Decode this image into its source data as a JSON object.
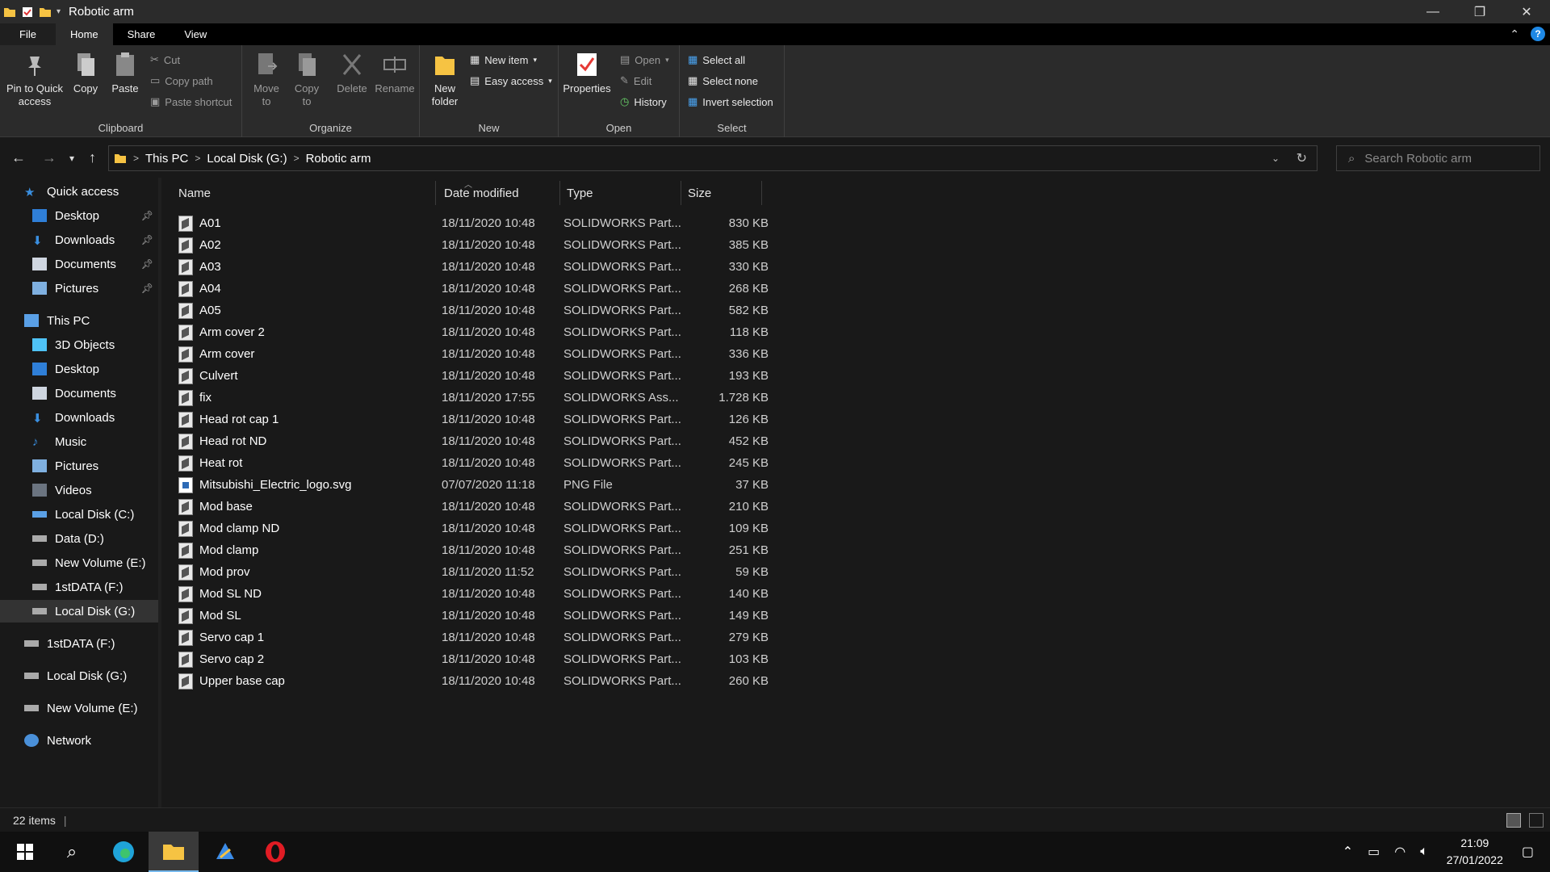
{
  "window": {
    "title": "Robotic arm"
  },
  "ribbon_tabs": [
    "File",
    "Home",
    "Share",
    "View"
  ],
  "ribbon": {
    "clipboard": {
      "label": "Clipboard",
      "pin": "Pin to Quick access",
      "copy": "Copy",
      "paste": "Paste",
      "cut": "Cut",
      "copy_path": "Copy path",
      "paste_shortcut": "Paste shortcut"
    },
    "organize": {
      "label": "Organize",
      "move_to": "Move to",
      "copy_to": "Copy to",
      "delete": "Delete",
      "rename": "Rename"
    },
    "new": {
      "label": "New",
      "new_folder": "New folder",
      "new_item": "New item",
      "easy_access": "Easy access"
    },
    "open": {
      "label": "Open",
      "properties": "Properties",
      "open": "Open",
      "edit": "Edit",
      "history": "History"
    },
    "select": {
      "label": "Select",
      "select_all": "Select all",
      "select_none": "Select none",
      "invert": "Invert selection"
    }
  },
  "address": {
    "crumbs": [
      "This PC",
      "Local Disk (G:)",
      "Robotic arm"
    ],
    "search_placeholder": "Search Robotic arm"
  },
  "sidebar": {
    "quick_access": "Quick access",
    "quick_items": [
      "Desktop",
      "Downloads",
      "Documents",
      "Pictures"
    ],
    "this_pc": "This PC",
    "pc_items": [
      "3D Objects",
      "Desktop",
      "Documents",
      "Downloads",
      "Music",
      "Pictures",
      "Videos",
      "Local Disk (C:)",
      "Data (D:)",
      "New Volume (E:)",
      "1stDATA (F:)",
      "Local Disk (G:)"
    ],
    "drives": [
      "1stDATA (F:)",
      "Local Disk (G:)",
      "New Volume (E:)"
    ],
    "network": "Network"
  },
  "columns": {
    "name": "Name",
    "date": "Date modified",
    "type": "Type",
    "size": "Size"
  },
  "files": [
    {
      "name": "A01",
      "date": "18/11/2020 10:48",
      "type": "SOLIDWORKS Part...",
      "size": "830 KB"
    },
    {
      "name": "A02",
      "date": "18/11/2020 10:48",
      "type": "SOLIDWORKS Part...",
      "size": "385 KB"
    },
    {
      "name": "A03",
      "date": "18/11/2020 10:48",
      "type": "SOLIDWORKS Part...",
      "size": "330 KB"
    },
    {
      "name": "A04",
      "date": "18/11/2020 10:48",
      "type": "SOLIDWORKS Part...",
      "size": "268 KB"
    },
    {
      "name": "A05",
      "date": "18/11/2020 10:48",
      "type": "SOLIDWORKS Part...",
      "size": "582 KB"
    },
    {
      "name": "Arm cover 2",
      "date": "18/11/2020 10:48",
      "type": "SOLIDWORKS Part...",
      "size": "118 KB"
    },
    {
      "name": "Arm cover",
      "date": "18/11/2020 10:48",
      "type": "SOLIDWORKS Part...",
      "size": "336 KB"
    },
    {
      "name": "Culvert",
      "date": "18/11/2020 10:48",
      "type": "SOLIDWORKS Part...",
      "size": "193 KB"
    },
    {
      "name": "fix",
      "date": "18/11/2020 17:55",
      "type": "SOLIDWORKS Ass...",
      "size": "1.728 KB"
    },
    {
      "name": "Head rot cap 1",
      "date": "18/11/2020 10:48",
      "type": "SOLIDWORKS Part...",
      "size": "126 KB"
    },
    {
      "name": "Head rot ND",
      "date": "18/11/2020 10:48",
      "type": "SOLIDWORKS Part...",
      "size": "452 KB"
    },
    {
      "name": "Heat rot",
      "date": "18/11/2020 10:48",
      "type": "SOLIDWORKS Part...",
      "size": "245 KB"
    },
    {
      "name": "Mitsubishi_Electric_logo.svg",
      "date": "07/07/2020 11:18",
      "type": "PNG File",
      "size": "37 KB"
    },
    {
      "name": "Mod base",
      "date": "18/11/2020 10:48",
      "type": "SOLIDWORKS Part...",
      "size": "210 KB"
    },
    {
      "name": "Mod clamp ND",
      "date": "18/11/2020 10:48",
      "type": "SOLIDWORKS Part...",
      "size": "109 KB"
    },
    {
      "name": "Mod clamp",
      "date": "18/11/2020 10:48",
      "type": "SOLIDWORKS Part...",
      "size": "251 KB"
    },
    {
      "name": "Mod prov",
      "date": "18/11/2020 11:52",
      "type": "SOLIDWORKS Part...",
      "size": "59 KB"
    },
    {
      "name": "Mod SL ND",
      "date": "18/11/2020 10:48",
      "type": "SOLIDWORKS Part...",
      "size": "140 KB"
    },
    {
      "name": "Mod SL",
      "date": "18/11/2020 10:48",
      "type": "SOLIDWORKS Part...",
      "size": "149 KB"
    },
    {
      "name": "Servo cap 1",
      "date": "18/11/2020 10:48",
      "type": "SOLIDWORKS Part...",
      "size": "279 KB"
    },
    {
      "name": "Servo cap 2",
      "date": "18/11/2020 10:48",
      "type": "SOLIDWORKS Part...",
      "size": "103 KB"
    },
    {
      "name": "Upper base cap",
      "date": "18/11/2020 10:48",
      "type": "SOLIDWORKS Part...",
      "size": "260 KB"
    }
  ],
  "status": {
    "count": "22 items"
  },
  "clock": {
    "time": "21:09",
    "date": "27/01/2022"
  },
  "colors": {
    "accent": "#1e88e5",
    "background": "#191919",
    "ribbon": "#2b2b2b",
    "folder": "#f6c343"
  }
}
